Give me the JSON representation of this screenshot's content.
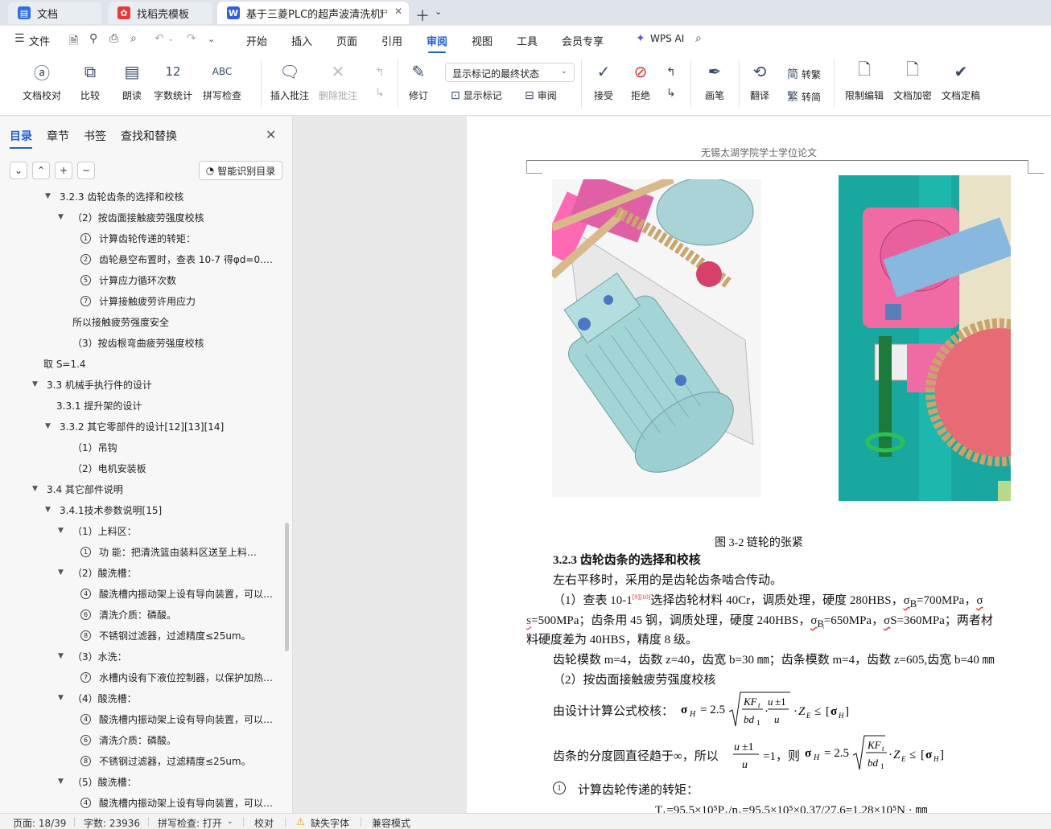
{
  "tabs": [
    {
      "label": "文档",
      "icon": "docs-icon",
      "color": "#2f6fe0"
    },
    {
      "label": "找稻壳模板",
      "icon": "docer-icon",
      "color": "#e5393b"
    },
    {
      "label": "基于三菱PLC的超声波清洗机F",
      "icon": "wps-writer-icon",
      "color": "#2f5fe0"
    }
  ],
  "menu": {
    "file": "文件",
    "items": [
      "开始",
      "插入",
      "页面",
      "引用",
      "审阅",
      "视图",
      "工具",
      "会员专享"
    ],
    "active": "审阅",
    "wps_ai": "WPS AI"
  },
  "ribbon": {
    "doc_check": "文档校对",
    "compare": "比较",
    "read_aloud": "朗读",
    "word_count": "字数统计",
    "spell_check": "拼写检查",
    "insert_comment": "插入批注",
    "delete_comment": "删除批注",
    "revise": "修订",
    "display_state": "显示标记的最终状态",
    "show_marks": "显示标记",
    "review": "审阅",
    "accept": "接受",
    "reject": "拒绝",
    "pen": "画笔",
    "translate": "翻译",
    "to_traditional": "转繁",
    "to_simplified": "转简",
    "restrict_edit": "限制编辑",
    "encrypt": "文档加密",
    "finalize": "文档定稿"
  },
  "nav": {
    "tabs": [
      "目录",
      "章节",
      "书签",
      "查找和替换"
    ],
    "active_tab": "目录",
    "smart_toc": "智能识别目录",
    "toc": [
      {
        "text": "3.2.3 齿轮齿条的选择和校核",
        "level": 3,
        "caret": "down"
      },
      {
        "text": "（2）按齿面接触疲劳强度校核",
        "level": 4,
        "caret": "down"
      },
      {
        "text": "计算齿轮传递的转矩：",
        "level": 5,
        "num": "1"
      },
      {
        "text": "齿轮悬空布置时，查表 10-7 得φd=0.…",
        "level": 5,
        "num": "2"
      },
      {
        "text": "计算应力循环次数",
        "level": 5,
        "num": "5"
      },
      {
        "text": "计算接触疲劳许用应力",
        "level": 5,
        "num": "7"
      },
      {
        "text": "所以接触疲劳强度安全",
        "level": 4
      },
      {
        "text": "（3）按齿根弯曲疲劳强度校核",
        "level": 4
      },
      {
        "text": "取 S=1.4",
        "level": 2
      },
      {
        "text": "3.3  机械手执行件的设计",
        "level": 2,
        "caret": "down"
      },
      {
        "text": "3.3.1  提升架的设计",
        "level": 3
      },
      {
        "text": "3.3.2  其它零部件的设计[12][13][14]",
        "level": 3,
        "caret": "down"
      },
      {
        "text": "（1）吊钩",
        "level": 4
      },
      {
        "text": "（2）电机安装板",
        "level": 4
      },
      {
        "text": "3.4  其它部件说明",
        "level": 2,
        "caret": "down"
      },
      {
        "text": "3.4.1技术参数说明[15]",
        "level": 3,
        "caret": "down"
      },
      {
        "text": "（1）上料区：",
        "level": 4,
        "caret": "down"
      },
      {
        "text": "功       能：把清洗篮由装料区送至上料…",
        "level": 5,
        "num": "1"
      },
      {
        "text": "（2）酸洗槽：",
        "level": 4,
        "caret": "down"
      },
      {
        "text": "酸洗槽内振动架上设有导向装置，可以…",
        "level": 5,
        "num": "4"
      },
      {
        "text": "清洗介质：磷酸。",
        "level": 5,
        "num": "6"
      },
      {
        "text": "不锈钢过滤器，过滤精度≤25um。",
        "level": 5,
        "num": "8"
      },
      {
        "text": "（3）水洗：",
        "level": 4,
        "caret": "down"
      },
      {
        "text": "水槽内设有下液位控制器，以保护加热…",
        "level": 5,
        "num": "7"
      },
      {
        "text": "（4）酸洗槽：",
        "level": 4,
        "caret": "down"
      },
      {
        "text": "酸洗槽内振动架上设有导向装置，可以…",
        "level": 5,
        "num": "4"
      },
      {
        "text": "清洗介质：磷酸。",
        "level": 5,
        "num": "6"
      },
      {
        "text": "不锈钢过滤器，过滤精度≤25um。",
        "level": 5,
        "num": "8"
      },
      {
        "text": "（5）酸洗槽：",
        "level": 4,
        "caret": "down"
      },
      {
        "text": "酸洗槽内振动架上设有导向装置，可以…",
        "level": 5,
        "num": "4"
      }
    ]
  },
  "doc": {
    "header": "无锡太湖学院学士学位论文",
    "figure_caption": "图 3-2  链轮的张紧",
    "heading": "3.2.3 齿轮齿条的选择和校核",
    "p1": "左右平移时，采用的是齿轮齿条啮合传动。",
    "p2a": "（1）查表 10-1",
    "p2_ref": "[9][10]",
    "p2b": "选择齿轮材料 40Cr，调质处理，硬度 280HBS，",
    "p2_sigma_b": "σ",
    "p2_b_sub": "B",
    "p2_b_val": "=700MPa，",
    "p2_sigma_end": "σ",
    "p3a": "S",
    "p3b": "=500MPa；齿条用 45 钢，调质处理，硬度 240HBS，",
    "p3_sigma_b": "σ",
    "p3_b_sub": "B",
    "p3_b_val": "=650MPa，",
    "p3_sigma_s": "σ",
    "p3_s_val": "S=360MPa；两者材",
    "p4": "料硬度差为 40HBS，精度 8 级。",
    "p5": "齿轮模数 m=4，齿数 z=40，齿宽 b=30 ㎜；齿条模数 m=4，齿数 z=605,齿宽 b=40 ㎜",
    "p6": "（2）按齿面接触疲劳强度校核",
    "p7": "由设计计算公式校核：",
    "p8a": "齿条的分度圆直径趋于∞，所以",
    "p8b": "=1，则",
    "p9_num": "1",
    "p9": "计算齿轮传递的转矩：",
    "p10": "T₁=95.5×10⁵P₁/n₁=95.5×10⁵×0.37/27.6=1.28×10⁵N · ㎜"
  },
  "status": {
    "page": "页面: 18/39",
    "words": "字数: 23936",
    "spell": "拼写检查: 打开",
    "proof": "校对",
    "missing_font": "缺失字体",
    "compat": "兼容模式"
  }
}
